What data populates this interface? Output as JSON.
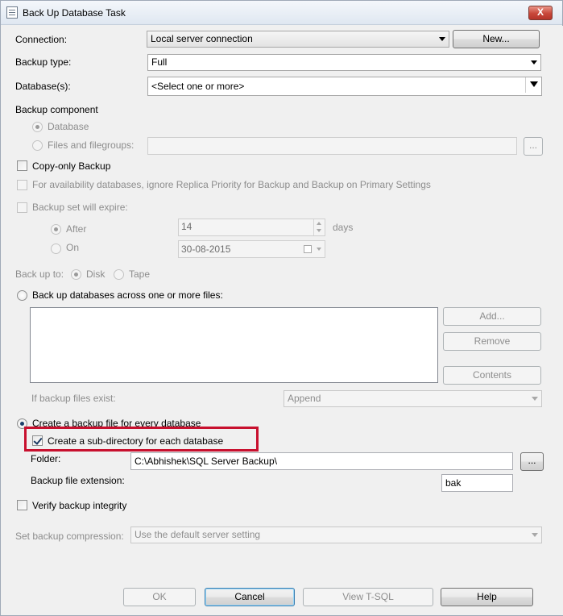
{
  "window": {
    "title": "Back Up Database Task",
    "close_label": "X"
  },
  "connection": {
    "label": "Connection:",
    "value": "Local server connection",
    "new_button": "New..."
  },
  "backup_type": {
    "label": "Backup type:",
    "value": "Full"
  },
  "databases": {
    "label": "Database(s):",
    "value": "<Select one or more>"
  },
  "backup_component": {
    "label": "Backup component",
    "options": [
      "Database",
      "Files and filegroups:"
    ],
    "selected": "Database",
    "browse_button": "..."
  },
  "copy_only": {
    "label": "Copy-only Backup",
    "checked": false
  },
  "availability": {
    "label": "For availability databases, ignore Replica Priority for Backup and Backup on Primary Settings",
    "checked": false
  },
  "expire": {
    "label": "Backup set will expire:",
    "after_label": "After",
    "after_value": "14",
    "after_unit": "days",
    "on_label": "On",
    "on_value": "30-08-2015"
  },
  "back_up_to": {
    "label": "Back up to:",
    "disk": "Disk",
    "tape": "Tape"
  },
  "across_files": {
    "label": "Back up databases across one or more files:"
  },
  "file_buttons": {
    "add": "Add...",
    "remove": "Remove",
    "contents": "Contents"
  },
  "if_exists": {
    "label": "If backup files exist:",
    "value": "Append"
  },
  "every_db": {
    "label": "Create a backup file for every database",
    "selected": true
  },
  "subdir": {
    "label": "Create a sub-directory for each database",
    "checked": true
  },
  "folder": {
    "label": "Folder:",
    "value": "C:\\Abhishek\\SQL Server Backup\\",
    "browse_button": "..."
  },
  "extension": {
    "label": "Backup file extension:",
    "value": "bak"
  },
  "verify": {
    "label": "Verify backup integrity",
    "checked": false
  },
  "compression": {
    "label": "Set backup compression:",
    "value": "Use the default server setting"
  },
  "footer": {
    "ok": "OK",
    "cancel": "Cancel",
    "view_tsql": "View T-SQL",
    "help": "Help"
  },
  "colors": {
    "highlight": "#c8102e",
    "disabled_text": "#8d8d8d",
    "background": "#f0f0f0"
  },
  "icons": [
    "task-icon",
    "close-icon",
    "dropdown-arrow-icon",
    "spinner-up-icon",
    "spinner-down-icon",
    "calendar-icon"
  ]
}
